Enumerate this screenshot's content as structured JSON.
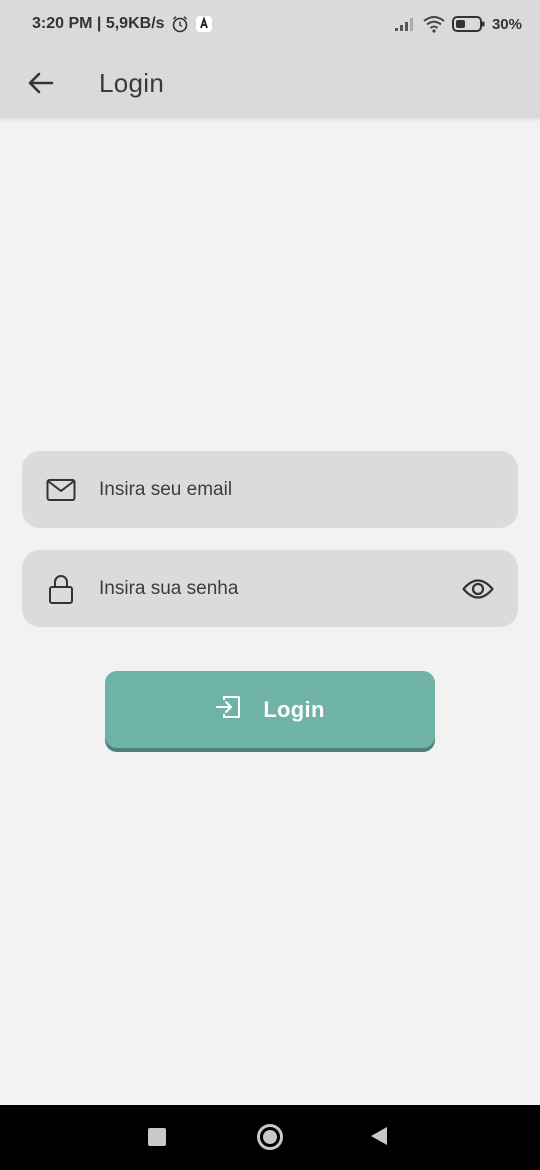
{
  "status_bar": {
    "time_speed": "3:20 PM | 5,9KB/s",
    "battery": "30%",
    "icons": [
      "alarm-icon",
      "notification-app-icon",
      "signal-icon",
      "wifi-icon",
      "battery-icon"
    ]
  },
  "app_bar": {
    "title": "Login",
    "back_icon": "arrow-left-icon"
  },
  "form": {
    "email": {
      "placeholder": "Insira seu email",
      "value": "",
      "icon": "mail-icon"
    },
    "password": {
      "placeholder": "Insira sua senha",
      "value": "",
      "icon": "lock-icon",
      "toggle_icon": "eye-icon"
    },
    "login_button": {
      "label": "Login",
      "icon": "login-icon"
    }
  },
  "colors": {
    "background": "#f2f2f2",
    "bars": "#dadada",
    "field_bg": "#dbdbdb",
    "accent": "#6fb2a6",
    "accent_shadow": "#4f8077"
  },
  "nav_bar": {
    "buttons": [
      "recent-apps-icon",
      "home-icon",
      "back-nav-icon"
    ]
  }
}
